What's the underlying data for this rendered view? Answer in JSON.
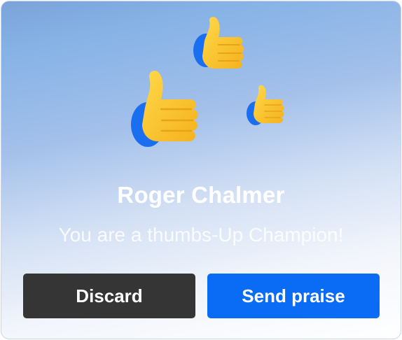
{
  "recipient": {
    "name": "Roger Chalmer",
    "message": "You are a thumbs-Up Champion!"
  },
  "actions": {
    "discard_label": "Discard",
    "send_label": "Send praise"
  },
  "icons": {
    "thumbs": [
      "thumbs-up-icon",
      "thumbs-up-icon",
      "thumbs-up-icon"
    ]
  },
  "colors": {
    "thumb_yellow": "#ffc72c",
    "thumb_cuff": "#1a6ef0",
    "discard_bg": "#353535",
    "send_bg": "#0a6cf5",
    "text": "#ffffff"
  }
}
